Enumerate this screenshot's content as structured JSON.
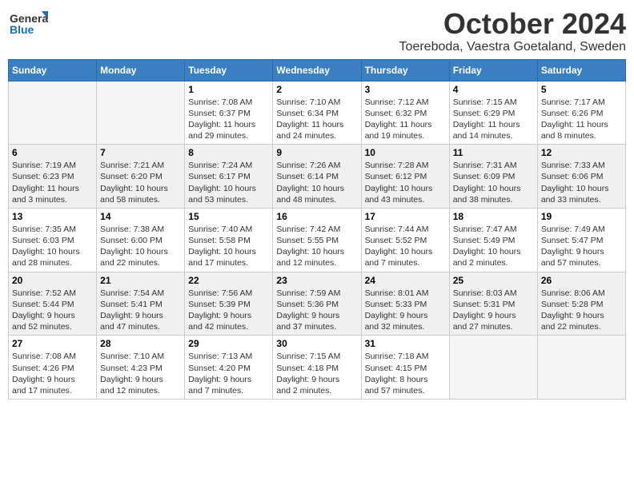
{
  "header": {
    "logo_general": "General",
    "logo_blue": "Blue",
    "month": "October 2024",
    "location": "Toereboda, Vaestra Goetaland, Sweden"
  },
  "weekdays": [
    "Sunday",
    "Monday",
    "Tuesday",
    "Wednesday",
    "Thursday",
    "Friday",
    "Saturday"
  ],
  "weeks": [
    [
      {
        "day": "",
        "lines": []
      },
      {
        "day": "",
        "lines": []
      },
      {
        "day": "1",
        "lines": [
          "Sunrise: 7:08 AM",
          "Sunset: 6:37 PM",
          "Daylight: 11 hours",
          "and 29 minutes."
        ]
      },
      {
        "day": "2",
        "lines": [
          "Sunrise: 7:10 AM",
          "Sunset: 6:34 PM",
          "Daylight: 11 hours",
          "and 24 minutes."
        ]
      },
      {
        "day": "3",
        "lines": [
          "Sunrise: 7:12 AM",
          "Sunset: 6:32 PM",
          "Daylight: 11 hours",
          "and 19 minutes."
        ]
      },
      {
        "day": "4",
        "lines": [
          "Sunrise: 7:15 AM",
          "Sunset: 6:29 PM",
          "Daylight: 11 hours",
          "and 14 minutes."
        ]
      },
      {
        "day": "5",
        "lines": [
          "Sunrise: 7:17 AM",
          "Sunset: 6:26 PM",
          "Daylight: 11 hours",
          "and 8 minutes."
        ]
      }
    ],
    [
      {
        "day": "6",
        "lines": [
          "Sunrise: 7:19 AM",
          "Sunset: 6:23 PM",
          "Daylight: 11 hours",
          "and 3 minutes."
        ]
      },
      {
        "day": "7",
        "lines": [
          "Sunrise: 7:21 AM",
          "Sunset: 6:20 PM",
          "Daylight: 10 hours",
          "and 58 minutes."
        ]
      },
      {
        "day": "8",
        "lines": [
          "Sunrise: 7:24 AM",
          "Sunset: 6:17 PM",
          "Daylight: 10 hours",
          "and 53 minutes."
        ]
      },
      {
        "day": "9",
        "lines": [
          "Sunrise: 7:26 AM",
          "Sunset: 6:14 PM",
          "Daylight: 10 hours",
          "and 48 minutes."
        ]
      },
      {
        "day": "10",
        "lines": [
          "Sunrise: 7:28 AM",
          "Sunset: 6:12 PM",
          "Daylight: 10 hours",
          "and 43 minutes."
        ]
      },
      {
        "day": "11",
        "lines": [
          "Sunrise: 7:31 AM",
          "Sunset: 6:09 PM",
          "Daylight: 10 hours",
          "and 38 minutes."
        ]
      },
      {
        "day": "12",
        "lines": [
          "Sunrise: 7:33 AM",
          "Sunset: 6:06 PM",
          "Daylight: 10 hours",
          "and 33 minutes."
        ]
      }
    ],
    [
      {
        "day": "13",
        "lines": [
          "Sunrise: 7:35 AM",
          "Sunset: 6:03 PM",
          "Daylight: 10 hours",
          "and 28 minutes."
        ]
      },
      {
        "day": "14",
        "lines": [
          "Sunrise: 7:38 AM",
          "Sunset: 6:00 PM",
          "Daylight: 10 hours",
          "and 22 minutes."
        ]
      },
      {
        "day": "15",
        "lines": [
          "Sunrise: 7:40 AM",
          "Sunset: 5:58 PM",
          "Daylight: 10 hours",
          "and 17 minutes."
        ]
      },
      {
        "day": "16",
        "lines": [
          "Sunrise: 7:42 AM",
          "Sunset: 5:55 PM",
          "Daylight: 10 hours",
          "and 12 minutes."
        ]
      },
      {
        "day": "17",
        "lines": [
          "Sunrise: 7:44 AM",
          "Sunset: 5:52 PM",
          "Daylight: 10 hours",
          "and 7 minutes."
        ]
      },
      {
        "day": "18",
        "lines": [
          "Sunrise: 7:47 AM",
          "Sunset: 5:49 PM",
          "Daylight: 10 hours",
          "and 2 minutes."
        ]
      },
      {
        "day": "19",
        "lines": [
          "Sunrise: 7:49 AM",
          "Sunset: 5:47 PM",
          "Daylight: 9 hours",
          "and 57 minutes."
        ]
      }
    ],
    [
      {
        "day": "20",
        "lines": [
          "Sunrise: 7:52 AM",
          "Sunset: 5:44 PM",
          "Daylight: 9 hours",
          "and 52 minutes."
        ]
      },
      {
        "day": "21",
        "lines": [
          "Sunrise: 7:54 AM",
          "Sunset: 5:41 PM",
          "Daylight: 9 hours",
          "and 47 minutes."
        ]
      },
      {
        "day": "22",
        "lines": [
          "Sunrise: 7:56 AM",
          "Sunset: 5:39 PM",
          "Daylight: 9 hours",
          "and 42 minutes."
        ]
      },
      {
        "day": "23",
        "lines": [
          "Sunrise: 7:59 AM",
          "Sunset: 5:36 PM",
          "Daylight: 9 hours",
          "and 37 minutes."
        ]
      },
      {
        "day": "24",
        "lines": [
          "Sunrise: 8:01 AM",
          "Sunset: 5:33 PM",
          "Daylight: 9 hours",
          "and 32 minutes."
        ]
      },
      {
        "day": "25",
        "lines": [
          "Sunrise: 8:03 AM",
          "Sunset: 5:31 PM",
          "Daylight: 9 hours",
          "and 27 minutes."
        ]
      },
      {
        "day": "26",
        "lines": [
          "Sunrise: 8:06 AM",
          "Sunset: 5:28 PM",
          "Daylight: 9 hours",
          "and 22 minutes."
        ]
      }
    ],
    [
      {
        "day": "27",
        "lines": [
          "Sunrise: 7:08 AM",
          "Sunset: 4:26 PM",
          "Daylight: 9 hours",
          "and 17 minutes."
        ]
      },
      {
        "day": "28",
        "lines": [
          "Sunrise: 7:10 AM",
          "Sunset: 4:23 PM",
          "Daylight: 9 hours",
          "and 12 minutes."
        ]
      },
      {
        "day": "29",
        "lines": [
          "Sunrise: 7:13 AM",
          "Sunset: 4:20 PM",
          "Daylight: 9 hours",
          "and 7 minutes."
        ]
      },
      {
        "day": "30",
        "lines": [
          "Sunrise: 7:15 AM",
          "Sunset: 4:18 PM",
          "Daylight: 9 hours",
          "and 2 minutes."
        ]
      },
      {
        "day": "31",
        "lines": [
          "Sunrise: 7:18 AM",
          "Sunset: 4:15 PM",
          "Daylight: 8 hours",
          "and 57 minutes."
        ]
      },
      {
        "day": "",
        "lines": []
      },
      {
        "day": "",
        "lines": []
      }
    ]
  ]
}
